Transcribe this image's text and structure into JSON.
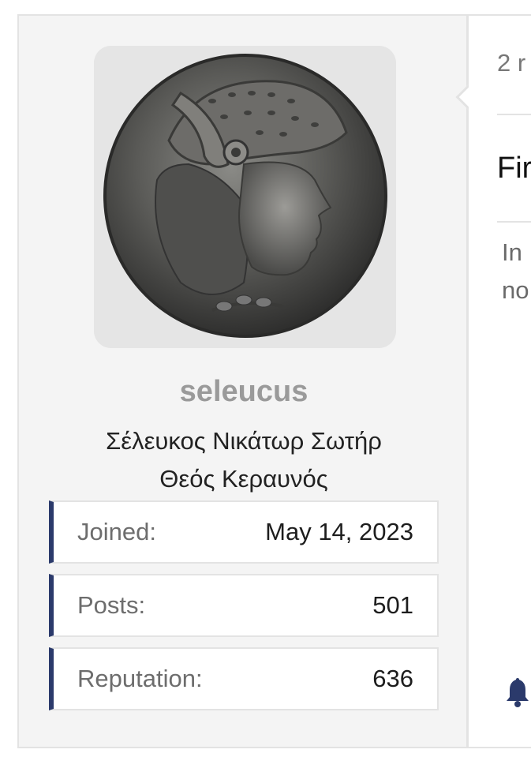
{
  "author": {
    "avatar_alt": "coin-portrait",
    "username": "seleucus",
    "title_line1": "Σέλευκος Νικάτωρ Σωτήρ",
    "title_line2": "Θεός Κεραυνός",
    "stats": [
      {
        "label": "Joined:",
        "value": "May 14, 2023"
      },
      {
        "label": "Posts:",
        "value": "501"
      },
      {
        "label": "Reputation:",
        "value": "636"
      }
    ]
  },
  "post": {
    "time_text": "2 r",
    "heading_text": "Fir",
    "body_line1": "In",
    "body_line2": "no"
  },
  "icons": {
    "notification": "bell-icon"
  },
  "colors": {
    "accent": "#2b3a6b",
    "username": "#9a9a9a",
    "panel_bg": "#f4f4f4"
  }
}
